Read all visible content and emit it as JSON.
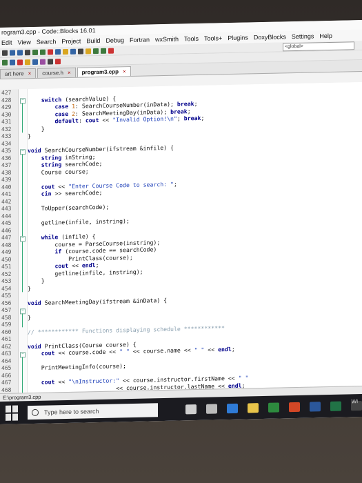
{
  "window": {
    "title": "rogram3.cpp - Code::Blocks 16.01"
  },
  "menu": [
    "Edit",
    "View",
    "Search",
    "Project",
    "Build",
    "Debug",
    "Fortran",
    "wxSmith",
    "Tools",
    "Tools+",
    "Plugins",
    "DoxyBlocks",
    "Settings",
    "Help"
  ],
  "toolbar": {
    "global_combo": "<global>"
  },
  "tabs": [
    {
      "label": "art here",
      "active": false
    },
    {
      "label": "course.h",
      "active": false
    },
    {
      "label": "program3.cpp",
      "active": true
    }
  ],
  "editor": {
    "lines": [
      {
        "n": "427",
        "code": ""
      },
      {
        "n": "428",
        "code": "    switch (searchValue) {"
      },
      {
        "n": "429",
        "code": "        case 1: SearchCourseNumber(inData); break;"
      },
      {
        "n": "430",
        "code": "        case 2: SearchMeetingDay(inData); break;"
      },
      {
        "n": "431",
        "code": "        default: cout << \"Invalid Option!\\n\"; break;"
      },
      {
        "n": "432",
        "code": "    }"
      },
      {
        "n": "433",
        "code": "}"
      },
      {
        "n": "434",
        "code": ""
      },
      {
        "n": "435",
        "code": "void SearchCourseNumber(ifstream &infile) {"
      },
      {
        "n": "436",
        "code": "    string inString;"
      },
      {
        "n": "437",
        "code": "    string searchCode;"
      },
      {
        "n": "438",
        "code": "    Course course;"
      },
      {
        "n": "439",
        "code": ""
      },
      {
        "n": "440",
        "code": "    cout << \"Enter Course Code to search: \";"
      },
      {
        "n": "441",
        "code": "    cin >> searchCode;"
      },
      {
        "n": "442",
        "code": ""
      },
      {
        "n": "443",
        "code": "    ToUpper(searchCode);"
      },
      {
        "n": "444",
        "code": ""
      },
      {
        "n": "445",
        "code": "    getline(infile, instring);"
      },
      {
        "n": "446",
        "code": ""
      },
      {
        "n": "447",
        "code": "    while (infile) {"
      },
      {
        "n": "448",
        "code": "        course = ParseCourse(instring);"
      },
      {
        "n": "449",
        "code": "        if (course.code == searchCode)"
      },
      {
        "n": "450",
        "code": "            PrintClass(course);"
      },
      {
        "n": "451",
        "code": "        cout << endl;"
      },
      {
        "n": "452",
        "code": "        getline(infile, instring);"
      },
      {
        "n": "453",
        "code": "    }"
      },
      {
        "n": "454",
        "code": "}"
      },
      {
        "n": "455",
        "code": ""
      },
      {
        "n": "456",
        "code": "void SearchMeetingDay(ifstream &inData) {"
      },
      {
        "n": "457",
        "code": ""
      },
      {
        "n": "458",
        "code": "}"
      },
      {
        "n": "459",
        "code": ""
      },
      {
        "n": "460",
        "code": "// ************ Functions displaying schedule ************"
      },
      {
        "n": "461",
        "code": ""
      },
      {
        "n": "462",
        "code": "void PrintClass(Course course) {"
      },
      {
        "n": "463",
        "code": "    cout << course.code << \" \" << course.name << \" \" << endl;"
      },
      {
        "n": "464",
        "code": ""
      },
      {
        "n": "465",
        "code": "    PrintMeetingInfo(course);"
      },
      {
        "n": "466",
        "code": ""
      },
      {
        "n": "467",
        "code": "    cout << \"\\nInstructor:\" << course.instructor.firstName << \" \""
      },
      {
        "n": "468",
        "code": "                          << course.instructor.lastName << endl;"
      }
    ]
  },
  "statusbar": {
    "text": "E:\\program3.cpp"
  },
  "taskbar": {
    "search_placeholder": "Type here to search",
    "right_label": "Wi"
  }
}
